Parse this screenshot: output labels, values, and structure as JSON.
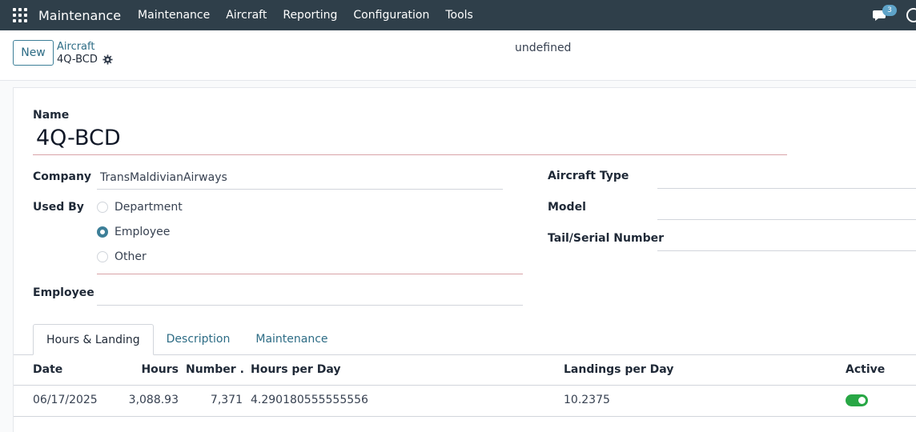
{
  "navbar": {
    "app_name": "Maintenance",
    "menu": [
      "Maintenance",
      "Aircraft",
      "Reporting",
      "Configuration",
      "Tools"
    ],
    "messages_count": "3",
    "icons": [
      "apps-grid-icon",
      "chat-icon",
      "clock-icon"
    ]
  },
  "control_panel": {
    "new_label": "New",
    "breadcrumb_parent": "Aircraft",
    "breadcrumb_current": "4Q-BCD",
    "status_text": "undefined"
  },
  "form": {
    "name_label": "Name",
    "name_value": "4Q-BCD",
    "company_label": "Company",
    "company_value": "TransMaldivianAirways",
    "used_by_label": "Used By",
    "used_by_options": [
      "Department",
      "Employee",
      "Other"
    ],
    "used_by_selected": "Employee",
    "employee_label": "Employee",
    "employee_value": "",
    "aircraft_type_label": "Aircraft Type",
    "model_label": "Model",
    "tail_label": "Tail/Serial Number"
  },
  "tabs": [
    "Hours & Landing",
    "Description",
    "Maintenance"
  ],
  "table": {
    "columns": [
      "Date",
      "Hours",
      "Number ...",
      "Hours per Day",
      "Landings per Day",
      "Active"
    ],
    "rows": [
      {
        "date": "06/17/2025",
        "hours": "3,088.93",
        "number": "7,371",
        "hours_per_day": "4.290180555555556",
        "landings_per_day": "10.2375",
        "active": true
      }
    ]
  },
  "colors": {
    "navbar": "#2f3f4a",
    "accent": "#3d7f98",
    "toggle_on": "#28a745"
  }
}
